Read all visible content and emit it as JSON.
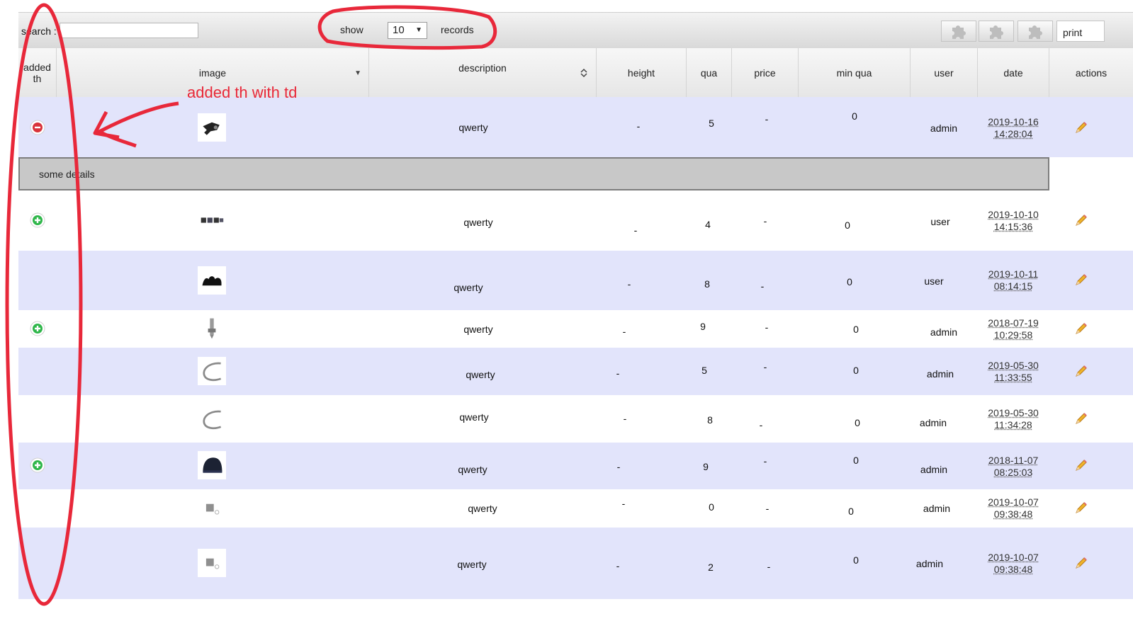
{
  "toolbar": {
    "search_label": "search :",
    "search_value": "",
    "show_label": "show",
    "records_value": "10",
    "records_label": "records",
    "print_label": "print",
    "plugin_icons": [
      "puzzle-icon",
      "puzzle-icon",
      "puzzle-icon"
    ]
  },
  "columns": [
    "added th",
    "image",
    "description",
    "height",
    "qua",
    "price",
    "min qua",
    "user",
    "date",
    "actions"
  ],
  "annotation": {
    "text": "added th with td",
    "color": "#e8283a"
  },
  "details_text": "some details",
  "rows": [
    {
      "toggle": "minus",
      "image": "tool",
      "description": "qwerty",
      "height": "-",
      "qua": "5",
      "price": "-",
      "min_qua": "0",
      "user": "admin",
      "date": "2019-10-16",
      "time": "14:28:04"
    },
    {
      "toggle": "plus",
      "image": "parts",
      "description": "qwerty",
      "height": "-",
      "qua": "4",
      "price": "-",
      "min_qua": "0",
      "user": "user",
      "date": "2019-10-10",
      "time": "14:15:36"
    },
    {
      "toggle": "",
      "image": "black",
      "description": "qwerty",
      "height": "-",
      "qua": "8",
      "price": "-",
      "min_qua": "0",
      "user": "user",
      "date": "2019-10-11",
      "time": "08:14:15"
    },
    {
      "toggle": "plus",
      "image": "bolt",
      "description": "qwerty",
      "height": "-",
      "qua": "9",
      "price": "-",
      "min_qua": "0",
      "user": "admin",
      "date": "2018-07-19",
      "time": "10:29:58"
    },
    {
      "toggle": "",
      "image": "hose",
      "description": "qwerty",
      "height": "-",
      "qua": "5",
      "price": "-",
      "min_qua": "0",
      "user": "admin",
      "date": "2019-05-30",
      "time": "11:33:55"
    },
    {
      "toggle": "",
      "image": "hose",
      "description": "qwerty",
      "height": "-",
      "qua": "8",
      "price": "-",
      "min_qua": "0",
      "user": "admin",
      "date": "2019-05-30",
      "time": "11:34:28"
    },
    {
      "toggle": "plus",
      "image": "hat",
      "description": "qwerty",
      "height": "-",
      "qua": "9",
      "price": "-",
      "min_qua": "0",
      "user": "admin",
      "date": "2018-11-07",
      "time": "08:25:03"
    },
    {
      "toggle": "",
      "image": "nut",
      "description": "qwerty",
      "height": "-",
      "qua": "0",
      "price": "-",
      "min_qua": "0",
      "user": "admin",
      "date": "2019-10-07",
      "time": "09:38:48"
    },
    {
      "toggle": "",
      "image": "nut",
      "description": "qwerty",
      "height": "-",
      "qua": "2",
      "price": "-",
      "min_qua": "0",
      "user": "admin",
      "date": "2019-10-07",
      "time": "09:38:48"
    }
  ]
}
